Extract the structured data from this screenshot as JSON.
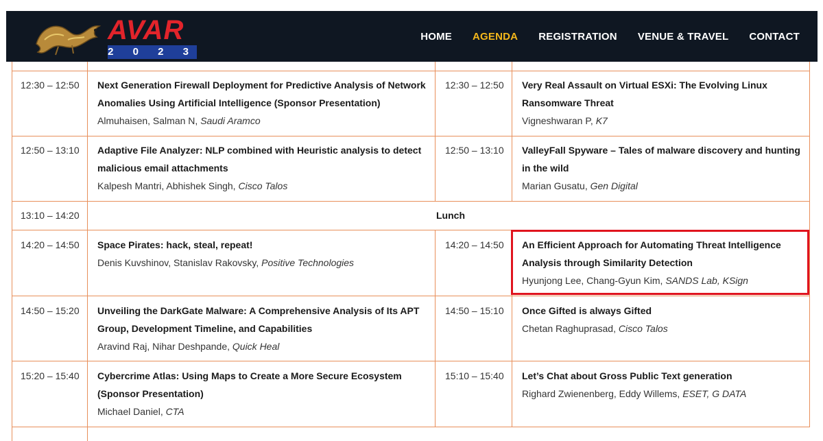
{
  "header": {
    "logo_text": "AVAR",
    "logo_year": "2 0 2 3",
    "nav": [
      {
        "label": "HOME"
      },
      {
        "label": "AGENDA",
        "active": true
      },
      {
        "label": "REGISTRATION"
      },
      {
        "label": "VENUE & TRAVEL"
      },
      {
        "label": "CONTACT"
      }
    ],
    "active_color": "#f5b81b"
  },
  "rows": [
    {
      "left": {
        "time": "12:30 – 12:50",
        "title": "Next Generation Firewall Deployment for Predictive Analysis of Network Anomalies Using Artificial Intelligence (Sponsor Presentation)",
        "authors": "Almuhaisen, Salman N, ",
        "org": "Saudi Aramco"
      },
      "right": {
        "time": "12:30 – 12:50",
        "title": "Very Real Assault on Virtual ESXi: The Evolving Linux Ransomware Threat",
        "authors": "Vigneshwaran P, ",
        "org": "K7"
      }
    },
    {
      "left": {
        "time": "12:50 – 13:10",
        "title": "Adaptive File Analyzer: NLP combined with Heuristic analysis to detect malicious email attachments",
        "authors": "Kalpesh Mantri, Abhishek Singh, ",
        "org": "Cisco Talos"
      },
      "right": {
        "time": "12:50 – 13:10",
        "title": "ValleyFall Spyware – Tales of malware discovery and hunting in the wild",
        "authors": "Marian Gusatu, ",
        "org": "Gen Digital"
      }
    },
    {
      "lunch": {
        "time": "13:10 – 14:20",
        "label": "Lunch"
      }
    },
    {
      "left": {
        "time": "14:20 – 14:50",
        "title": "Space Pirates: hack, steal, repeat!",
        "authors": "Denis Kuvshinov, Stanislav Rakovsky, ",
        "org": "Positive Technologies"
      },
      "right": {
        "time": "14:20 – 14:50",
        "title": "An Efficient Approach for Automating Threat Intelligence Analysis through Similarity Detection",
        "authors": "Hyunjong Lee, Chang-Gyun Kim, ",
        "org": "SANDS Lab, KSign"
      }
    },
    {
      "left": {
        "time": "14:50 – 15:20",
        "title": "Unveiling the DarkGate Malware: A Comprehensive Analysis of Its APT Group, Development Timeline, and Capabilities",
        "authors": "Aravind Raj, Nihar Deshpande, ",
        "org": "Quick Heal"
      },
      "right": {
        "time": "14:50 – 15:10",
        "title": "Once Gifted is always Gifted",
        "authors": "Chetan Raghuprasad, ",
        "org": "Cisco Talos"
      }
    },
    {
      "left": {
        "time": "15:20 – 15:40",
        "title": "Cybercrime Atlas: Using Maps to Create a More Secure Ecosystem (Sponsor Presentation)",
        "authors": "Michael Daniel, ",
        "org": "CTA"
      },
      "right": {
        "time": "15:10 – 15:40",
        "title": "Let’s Chat about Gross Public Text generation",
        "authors": "Righard Zwienenberg, Eddy Willems, ",
        "org": "ESET, G DATA"
      }
    }
  ],
  "grid_color": "#e88f5a",
  "highlight_color": "#e0141e"
}
